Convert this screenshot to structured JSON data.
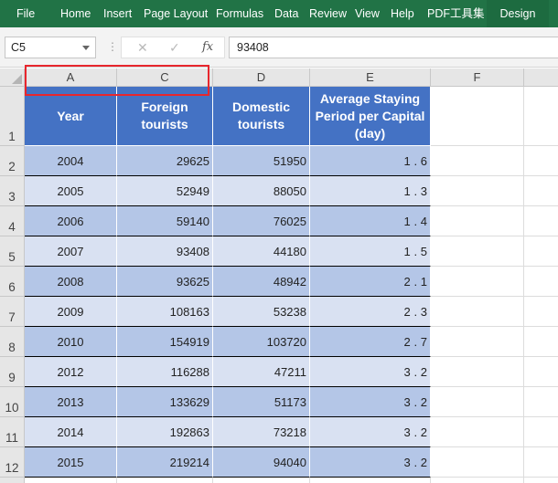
{
  "menu": {
    "items": [
      "File",
      "Home",
      "Insert",
      "Page Layout",
      "Formulas",
      "Data",
      "Review",
      "View",
      "Help",
      "PDF工具集",
      "Design"
    ]
  },
  "formula_bar": {
    "name_box": "C5",
    "cancel_icon": "✕",
    "confirm_icon": "✓",
    "fx_label": "fx",
    "value": "93408"
  },
  "columns": [
    "A",
    "C",
    "D",
    "E",
    "F"
  ],
  "rows": [
    "1",
    "2",
    "3",
    "4",
    "5",
    "6",
    "7",
    "8",
    "9",
    "10",
    "11",
    "12"
  ],
  "table": {
    "headers": {
      "year": "Year",
      "foreign": "Foreign tourists",
      "domestic": "Domestic tourists",
      "stay": "Average Staying Period per Capital (day)"
    },
    "rows": [
      {
        "year": "2004",
        "foreign": "29625",
        "domestic": "51950",
        "stay_int": "1",
        "stay_dec": "6"
      },
      {
        "year": "2005",
        "foreign": "52949",
        "domestic": "88050",
        "stay_int": "1",
        "stay_dec": "3"
      },
      {
        "year": "2006",
        "foreign": "59140",
        "domestic": "76025",
        "stay_int": "1",
        "stay_dec": "4"
      },
      {
        "year": "2007",
        "foreign": "93408",
        "domestic": "44180",
        "stay_int": "1",
        "stay_dec": "5"
      },
      {
        "year": "2008",
        "foreign": "93625",
        "domestic": "48942",
        "stay_int": "2",
        "stay_dec": "1"
      },
      {
        "year": "2009",
        "foreign": "108163",
        "domestic": "53238",
        "stay_int": "2",
        "stay_dec": "3"
      },
      {
        "year": "2010",
        "foreign": "154919",
        "domestic": "103720",
        "stay_int": "2",
        "stay_dec": "7"
      },
      {
        "year": "2012",
        "foreign": "116288",
        "domestic": "47211",
        "stay_int": "3",
        "stay_dec": "2"
      },
      {
        "year": "2013",
        "foreign": "133629",
        "domestic": "51173",
        "stay_int": "3",
        "stay_dec": "2"
      },
      {
        "year": "2014",
        "foreign": "192863",
        "domestic": "73218",
        "stay_int": "3",
        "stay_dec": "2"
      },
      {
        "year": "2015",
        "foreign": "219214",
        "domestic": "94040",
        "stay_int": "3",
        "stay_dec": "2"
      }
    ]
  },
  "colors": {
    "ribbon": "#217346",
    "header_fill": "#4472c4",
    "band_dark": "#b4c6e7",
    "band_light": "#d9e1f2",
    "selection_outline": "#e8262d"
  }
}
